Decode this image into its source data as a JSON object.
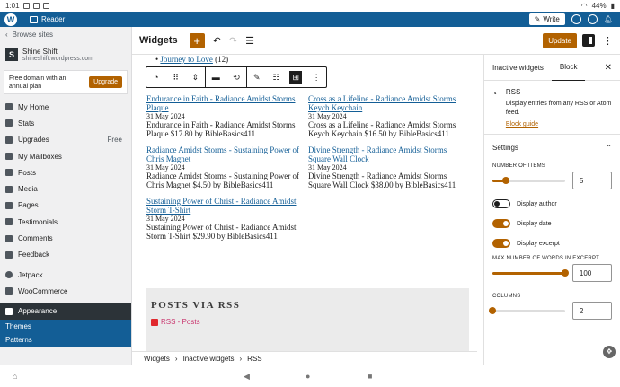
{
  "status": {
    "time": "1:01",
    "battery": "44%"
  },
  "wpbar": {
    "app": "Reader",
    "write": "Write"
  },
  "sidebar": {
    "browse": "Browse sites",
    "site_name": "Shine Shift",
    "site_url": "shineshift.wordpress.com",
    "promo_text": "Free domain with an annual plan",
    "promo_button": "Upgrade",
    "items": [
      {
        "label": "My Home"
      },
      {
        "label": "Stats"
      },
      {
        "label": "Upgrades",
        "badge": "Free"
      },
      {
        "label": "My Mailboxes"
      },
      {
        "label": "Posts"
      },
      {
        "label": "Media"
      },
      {
        "label": "Pages"
      },
      {
        "label": "Testimonials"
      },
      {
        "label": "Comments"
      },
      {
        "label": "Feedback"
      },
      {
        "label": "Jetpack"
      },
      {
        "label": "WooCommerce"
      },
      {
        "label": "Appearance"
      }
    ],
    "sub": [
      "Themes",
      "Patterns"
    ]
  },
  "editor": {
    "title": "Widgets",
    "update": "Update"
  },
  "canvas": {
    "hidden_items": [
      {
        "text": "Journey to Love",
        "count": "(12)"
      }
    ],
    "posts": [
      {
        "title": "Endurance in Faith - Radiance Amidst Storms Plaque",
        "date": "31 May 2024",
        "desc": "Endurance in Faith - Radiance Amidst Storms Plaque $17.80 by BibleBasics411"
      },
      {
        "title": "Cross as a Lifeline - Radiance Amidst Storms Keych Keychain",
        "date": "31 May 2024",
        "desc": "Cross as a Lifeline - Radiance Amidst Storms Keych Keychain $16.50 by BibleBasics411"
      },
      {
        "title": "Radiance Amidst Storms - Sustaining Power of Chris Magnet",
        "date": "31 May 2024",
        "desc": "Radiance Amidst Storms - Sustaining Power of Chris Magnet $4.50 by BibleBasics411"
      },
      {
        "title": "Divine Strength - Radiance Amidst Storms Square Wall Clock",
        "date": "31 May 2024",
        "desc": "Divine Strength - Radiance Amidst Storms Square Wall Clock $38.00 by BibleBasics411"
      },
      {
        "title": "Sustaining Power of Christ - Radiance Amidst Storm T-Shirt",
        "date": "31 May 2024",
        "desc": "Sustaining Power of Christ - Radiance Amidst Storm T-Shirt $29.90 by BibleBasics411"
      }
    ],
    "rss_title": "POSTS VIA RSS",
    "rss_link": "RSS - Posts"
  },
  "breadcrumb": [
    "Widgets",
    "Inactive widgets",
    "RSS"
  ],
  "panel": {
    "tab_inactive": "Inactive widgets",
    "tab_block": "Block",
    "block_title": "RSS",
    "block_desc": "Display entries from any RSS or Atom feed.",
    "block_guide": "Block guide",
    "settings": "Settings",
    "num_items_label": "NUMBER OF ITEMS",
    "num_items": 5,
    "num_items_fraction": 0.18,
    "display_author": "Display author",
    "display_author_on": false,
    "display_date": "Display date",
    "display_date_on": true,
    "display_excerpt": "Display excerpt",
    "display_excerpt_on": true,
    "max_words_label": "MAX NUMBER OF WORDS IN EXCERPT",
    "max_words": 100,
    "max_words_fraction": 1.0,
    "columns_label": "COLUMNS",
    "columns": 2,
    "columns_fraction": 0.0
  },
  "colors": {
    "accent": "#b26200",
    "wp_blue": "#135e96",
    "dark": "#1e1e1e"
  }
}
